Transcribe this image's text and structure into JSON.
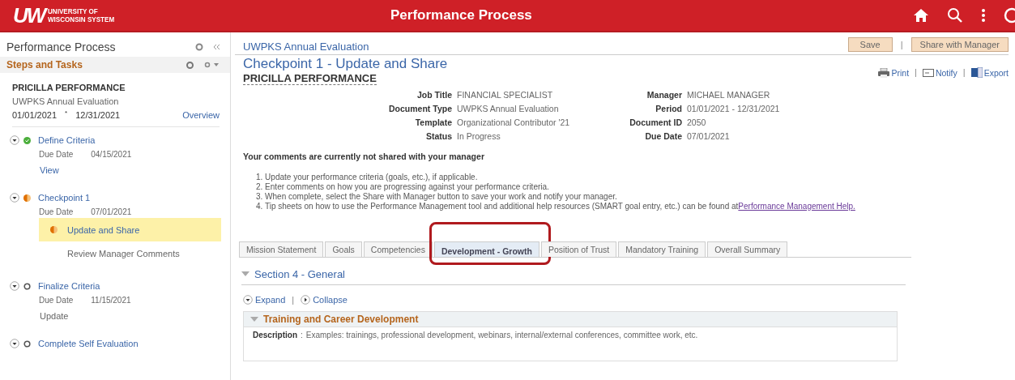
{
  "header": {
    "logo": {
      "mark": "UW",
      "line1": "UNIVERSITY OF",
      "line2": "WISCONSIN SYSTEM"
    },
    "title": "Performance Process"
  },
  "sidebar": {
    "title": "Performance Process",
    "section": "Steps and Tasks",
    "employee": "PRICILLA PERFORMANCE",
    "document": "UWPKS Annual Evaluation",
    "period_start": "01/01/2021",
    "period_separator": "*",
    "period_end": "12/31/2021",
    "overview_link": "Overview",
    "steps": [
      {
        "name": "Define Criteria",
        "kind": "complete",
        "due_label": "Due Date",
        "due": "04/15/2021",
        "tasks": [
          {
            "kind": "link",
            "label": "View"
          }
        ]
      },
      {
        "name": "Checkpoint 1",
        "kind": "in_progress",
        "due_label": "Due Date",
        "due": "07/01/2021",
        "tasks": [
          {
            "kind": "task",
            "label": "Update and Share",
            "in_progress": true,
            "selected": true
          },
          {
            "kind": "task",
            "label": "Review Manager Comments",
            "in_progress": false,
            "selected": false
          }
        ]
      },
      {
        "name": "Finalize Criteria",
        "kind": "not_started",
        "due_label": "Due Date",
        "due": "11/15/2021",
        "tasks": [
          {
            "kind": "text",
            "label": "Update"
          }
        ]
      },
      {
        "name": "Complete Self Evaluation",
        "kind": "not_started"
      }
    ]
  },
  "main": {
    "document": "UWPKS Annual Evaluation",
    "buttons": [
      "Save",
      "Share with Manager"
    ],
    "separator": "|",
    "title": "Checkpoint 1 - Update and Share",
    "employee": "PRICILLA PERFORMANCE",
    "actions": [
      "Print",
      "Notify",
      "Export"
    ],
    "fields_left": [
      {
        "label": "Job Title",
        "value": "FINANCIAL SPECIALIST"
      },
      {
        "label": "Document Type",
        "value": "UWPKS Annual Evaluation"
      },
      {
        "label": "Template",
        "value": "Organizational Contributor '21"
      },
      {
        "label": "Status",
        "value": "In Progress"
      }
    ],
    "fields_right": [
      {
        "label": "Manager",
        "value": "MICHAEL MANAGER"
      },
      {
        "label": "Period",
        "value": "01/01/2021  -  12/31/2021"
      },
      {
        "label": "Document ID",
        "value": "2050"
      },
      {
        "label": "Due Date",
        "value": "07/01/2021"
      }
    ],
    "notice": "Your comments are currently not shared with your manager",
    "instructions": [
      {
        "text": "1. Update your performance criteria (goals, etc.), if applicable."
      },
      {
        "text": "2. Enter comments on how you are progressing against your performance criteria."
      },
      {
        "text": "3. When complete, select the Share with Manager button to save your work and notify your manager."
      },
      {
        "text": "4. Tip sheets on how to use the Performance Management tool and additional help resources (SMART goal entry, etc.) can be found at",
        "link": "Performance Management Help."
      }
    ],
    "tabs": [
      {
        "label": "Mission Statement",
        "selected": false,
        "highlighted": false
      },
      {
        "label": "Goals",
        "selected": false,
        "highlighted": false
      },
      {
        "label": "Competencies",
        "selected": false,
        "highlighted": false
      },
      {
        "label": "Development - Growth",
        "selected": true,
        "highlighted": true
      },
      {
        "label": "Position of Trust",
        "selected": false,
        "highlighted": false
      },
      {
        "label": "Mandatory Training",
        "selected": false,
        "highlighted": false
      },
      {
        "label": "Overall Summary",
        "selected": false,
        "highlighted": false
      }
    ],
    "section": "Section 4 - General",
    "expand": "Expand",
    "collapse": "Collapse",
    "item": {
      "title": "Training and Career Development",
      "description_label": "Description",
      "description_separator": ":",
      "description": "Examples: trainings, professional development, webinars, internal/external conferences, committee work, etc."
    }
  }
}
